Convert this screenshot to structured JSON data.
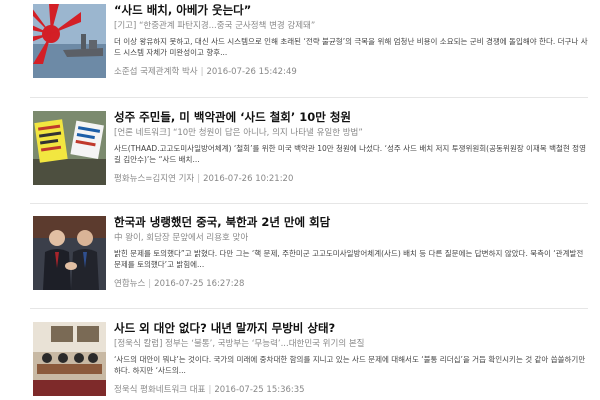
{
  "articles": [
    {
      "title": "“사드 배치, 아베가 웃는다”",
      "subtitle": "[기고] “한중관계 파탄지경...중국 군사정책 변경 강제돼”",
      "body": "더 이상 왕유하지 못하고, 대신 사드 시스템으로 인해 초래된 ‘전략 불균형’의 극복을 위해 엄청난 비용이 소요되는 군비 경쟁에 돌입해야 한다. 더구나 사드 시스템 자체가 미완성이고 향후...",
      "author": "소준섭 국제관계학 박사",
      "date": "2016-07-26 15:42:49"
    },
    {
      "title": "성주 주민들, 미 백악관에 ‘사드 철회’ 10만 청원",
      "subtitle": "[언론 네트워크] “10만 청원이 답은 아니나, 의지 나타낼 유일한 방법”",
      "body": "사드(THAAD.고고도미사일방어체계) ‘철회’를 위한 미국 백악관 10만 청원에 나섰다. ‘성주 사드 배치 저지 투쟁위원회(공동위원장 이재복 백철현 정영길 김안수)’는 “사드 배치...",
      "author": "평화뉴스=김지연 기자",
      "date": "2016-07-26 10:21:20"
    },
    {
      "title": "한국과 냉랭했던 중국, 북한과 2년 만에 회담",
      "subtitle": "中 왕이, 회담장 문앞에서 리용호 맞아",
      "body": "밝힌 문제를 토의했다”고 밝혔다. 다만 그는 ‘핵 문제, 주한미군 고고도미사일방어체계(사드) 배치 등 다른 질문에는 답변하지 않았다. 북측이 ‘관계발전 문제를 토의했다’고 밝힘에...",
      "author": "연합뉴스",
      "date": "2016-07-25 16:27:28"
    },
    {
      "title": "사드 외 대안 없다? 내년 말까지 무방비 상태?",
      "subtitle": "[정욱식 칼럼] 정부는 ‘불통’, 국방부는 ‘무능력’...대한민국 위기의 본질",
      "body": "‘사드의 대안이 뭐냐’는 것이다. 국가의 미래에 중차대한 함의를 지니고 있는 사드 문제에 대해서도 ‘불통 리더십’을 거듭 확인시키는 것 같아 씁쓸하기만 하다. 하지만 ‘사드의...",
      "author": "정욱식 평화네트워크 대표",
      "date": "2016-07-25 15:36:35"
    }
  ],
  "thumbnails": [
    {
      "icon": "rising-sun-flag-warship-photo"
    },
    {
      "icon": "protest-signs-photo"
    },
    {
      "icon": "diplomats-handshake-photo"
    },
    {
      "icon": "meeting-room-photo"
    }
  ]
}
